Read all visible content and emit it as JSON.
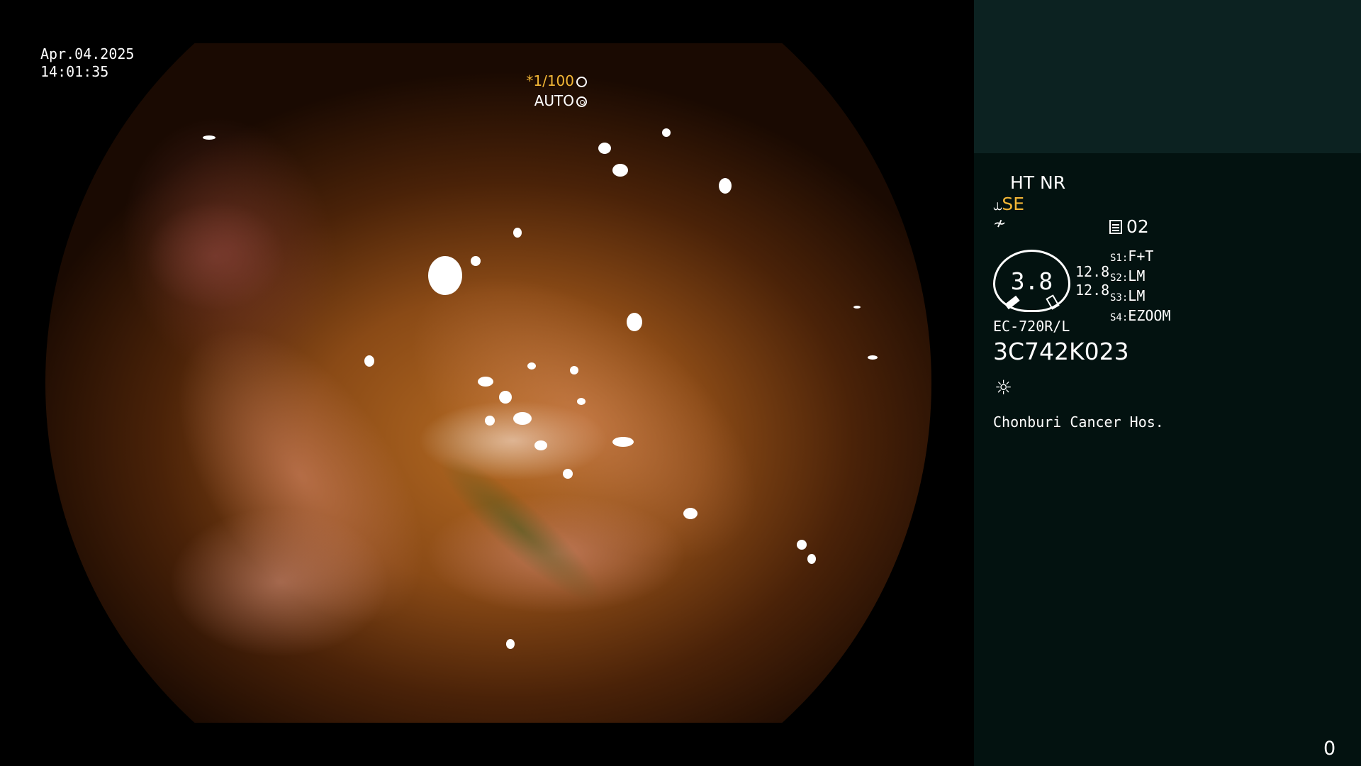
{
  "overlay": {
    "date": "Apr.04.2025",
    "time": "14:01:35",
    "shutter_speed": "*1/100",
    "iris_mode": "AUTO"
  },
  "side_panel": {
    "enhancement": "HT NR",
    "structure_mode": "SE",
    "memory_number": "02",
    "zoom_value": "3.8",
    "readings": [
      "12.8",
      "12.8"
    ],
    "switch_settings": [
      {
        "slot": "S1:",
        "value": "F+T"
      },
      {
        "slot": "S2:",
        "value": "LM"
      },
      {
        "slot": "S3:",
        "value": "LM"
      },
      {
        "slot": "S4:",
        "value": "EZOOM"
      }
    ],
    "scope_model": "EC-720R/L",
    "serial_number": "3C742K023",
    "hospital": "Chonburi Cancer Hos."
  },
  "footer": {
    "counter": "0"
  },
  "icons": {
    "shutter": "aperture-icon",
    "iris": "iris-icon",
    "structure": "scope-tip-icon",
    "freeze": "freeze-icon",
    "memory": "memory-icon",
    "light": "light-source-icon"
  },
  "colors": {
    "accent": "#f2b636",
    "panel_bg": "#031210",
    "panel_top": "#0c2221"
  }
}
